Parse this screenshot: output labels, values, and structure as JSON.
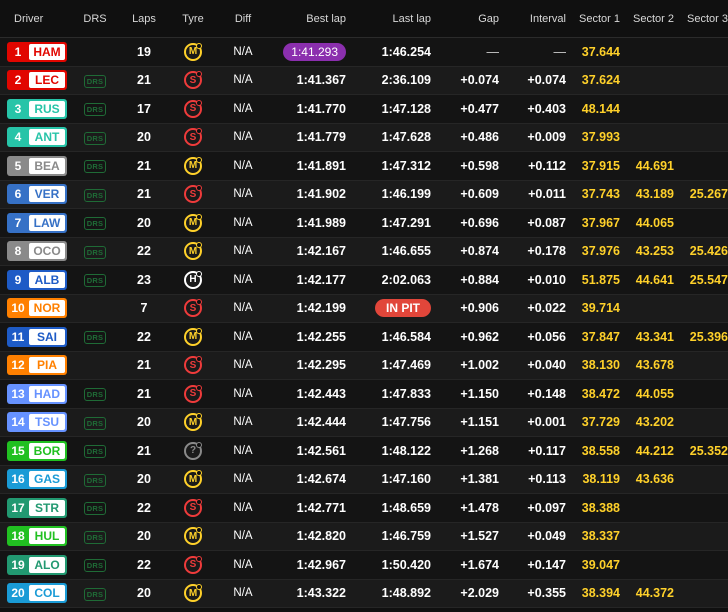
{
  "columns": {
    "driver": "Driver",
    "drs": "DRS",
    "laps": "Laps",
    "tyre": "Tyre",
    "diff": "Diff",
    "best_lap": "Best lap",
    "last_lap": "Last lap",
    "gap": "Gap",
    "interval": "Interval",
    "sector1": "Sector 1",
    "sector2": "Sector 2",
    "sector3": "Sector 3"
  },
  "tyre_colors": {
    "S": "#ef3b3b",
    "M": "#ffd12a",
    "H": "#ffffff",
    "?": "#8a8a8a"
  },
  "rows": [
    {
      "pos": "1",
      "abbr": "HAM",
      "team_color": "#e10600",
      "drs": "",
      "laps": "19",
      "tyre": "M",
      "diff": "N/A",
      "best_lap": "1:41.293",
      "best_purple": true,
      "last_lap": "1:46.254",
      "in_pit": false,
      "gap": "—",
      "interval": "—",
      "s1": "37.644",
      "s2": "",
      "s3": ""
    },
    {
      "pos": "2",
      "abbr": "LEC",
      "team_color": "#e10600",
      "drs": "DRS",
      "laps": "21",
      "tyre": "S",
      "diff": "N/A",
      "best_lap": "1:41.367",
      "best_purple": false,
      "last_lap": "2:36.109",
      "in_pit": false,
      "gap": "+0.074",
      "interval": "+0.074",
      "s1": "37.624",
      "s2": "",
      "s3": ""
    },
    {
      "pos": "3",
      "abbr": "RUS",
      "team_color": "#27c4a8",
      "drs": "DRS",
      "laps": "17",
      "tyre": "S",
      "diff": "N/A",
      "best_lap": "1:41.770",
      "best_purple": false,
      "last_lap": "1:47.128",
      "in_pit": false,
      "gap": "+0.477",
      "interval": "+0.403",
      "s1": "48.144",
      "s2": "",
      "s3": ""
    },
    {
      "pos": "4",
      "abbr": "ANT",
      "team_color": "#27c4a8",
      "drs": "DRS",
      "laps": "20",
      "tyre": "S",
      "diff": "N/A",
      "best_lap": "1:41.779",
      "best_purple": false,
      "last_lap": "1:47.628",
      "in_pit": false,
      "gap": "+0.486",
      "interval": "+0.009",
      "s1": "37.993",
      "s2": "",
      "s3": ""
    },
    {
      "pos": "5",
      "abbr": "BEA",
      "team_color": "#8a8a8a",
      "drs": "DRS",
      "laps": "21",
      "tyre": "M",
      "diff": "N/A",
      "best_lap": "1:41.891",
      "best_purple": false,
      "last_lap": "1:47.312",
      "in_pit": false,
      "gap": "+0.598",
      "interval": "+0.112",
      "s1": "37.915",
      "s2": "44.691",
      "s3": ""
    },
    {
      "pos": "6",
      "abbr": "VER",
      "team_color": "#3671c6",
      "drs": "DRS",
      "laps": "21",
      "tyre": "S",
      "diff": "N/A",
      "best_lap": "1:41.902",
      "best_purple": false,
      "last_lap": "1:46.199",
      "in_pit": false,
      "gap": "+0.609",
      "interval": "+0.011",
      "s1": "37.743",
      "s2": "43.189",
      "s3": "25.267"
    },
    {
      "pos": "7",
      "abbr": "LAW",
      "team_color": "#3671c6",
      "drs": "DRS",
      "laps": "20",
      "tyre": "M",
      "diff": "N/A",
      "best_lap": "1:41.989",
      "best_purple": false,
      "last_lap": "1:47.291",
      "in_pit": false,
      "gap": "+0.696",
      "interval": "+0.087",
      "s1": "37.967",
      "s2": "44.065",
      "s3": ""
    },
    {
      "pos": "8",
      "abbr": "OCO",
      "team_color": "#8a8a8a",
      "drs": "DRS",
      "laps": "22",
      "tyre": "M",
      "diff": "N/A",
      "best_lap": "1:42.167",
      "best_purple": false,
      "last_lap": "1:46.655",
      "in_pit": false,
      "gap": "+0.874",
      "interval": "+0.178",
      "s1": "37.976",
      "s2": "43.253",
      "s3": "25.426"
    },
    {
      "pos": "9",
      "abbr": "ALB",
      "team_color": "#1e5bc6",
      "drs": "DRS",
      "laps": "23",
      "tyre": "H",
      "diff": "N/A",
      "best_lap": "1:42.177",
      "best_purple": false,
      "last_lap": "2:02.063",
      "in_pit": false,
      "gap": "+0.884",
      "interval": "+0.010",
      "s1": "51.875",
      "s2": "44.641",
      "s3": "25.547"
    },
    {
      "pos": "10",
      "abbr": "NOR",
      "team_color": "#ff8000",
      "drs": "",
      "laps": "7",
      "tyre": "S",
      "diff": "N/A",
      "best_lap": "1:42.199",
      "best_purple": false,
      "last_lap": "IN PIT",
      "in_pit": true,
      "gap": "+0.906",
      "interval": "+0.022",
      "s1": "39.714",
      "s2": "",
      "s3": ""
    },
    {
      "pos": "11",
      "abbr": "SAI",
      "team_color": "#1e5bc6",
      "drs": "DRS",
      "laps": "22",
      "tyre": "M",
      "diff": "N/A",
      "best_lap": "1:42.255",
      "best_purple": false,
      "last_lap": "1:46.584",
      "in_pit": false,
      "gap": "+0.962",
      "interval": "+0.056",
      "s1": "37.847",
      "s2": "43.341",
      "s3": "25.396"
    },
    {
      "pos": "12",
      "abbr": "PIA",
      "team_color": "#ff8000",
      "drs": "",
      "laps": "21",
      "tyre": "S",
      "diff": "N/A",
      "best_lap": "1:42.295",
      "best_purple": false,
      "last_lap": "1:47.469",
      "in_pit": false,
      "gap": "+1.002",
      "interval": "+0.040",
      "s1": "38.130",
      "s2": "43.678",
      "s3": ""
    },
    {
      "pos": "13",
      "abbr": "HAD",
      "team_color": "#6692ff",
      "drs": "DRS",
      "laps": "21",
      "tyre": "S",
      "diff": "N/A",
      "best_lap": "1:42.443",
      "best_purple": false,
      "last_lap": "1:47.833",
      "in_pit": false,
      "gap": "+1.150",
      "interval": "+0.148",
      "s1": "38.472",
      "s2": "44.055",
      "s3": ""
    },
    {
      "pos": "14",
      "abbr": "TSU",
      "team_color": "#6692ff",
      "drs": "DRS",
      "laps": "20",
      "tyre": "M",
      "diff": "N/A",
      "best_lap": "1:42.444",
      "best_purple": false,
      "last_lap": "1:47.756",
      "in_pit": false,
      "gap": "+1.151",
      "interval": "+0.001",
      "s1": "37.729",
      "s2": "43.202",
      "s3": ""
    },
    {
      "pos": "15",
      "abbr": "BOR",
      "team_color": "#21c021",
      "drs": "DRS",
      "laps": "21",
      "tyre": "?",
      "diff": "N/A",
      "best_lap": "1:42.561",
      "best_purple": false,
      "last_lap": "1:48.122",
      "in_pit": false,
      "gap": "+1.268",
      "interval": "+0.117",
      "s1": "38.558",
      "s2": "44.212",
      "s3": "25.352"
    },
    {
      "pos": "16",
      "abbr": "GAS",
      "team_color": "#1a9bd6",
      "drs": "DRS",
      "laps": "20",
      "tyre": "M",
      "diff": "N/A",
      "best_lap": "1:42.674",
      "best_purple": false,
      "last_lap": "1:47.160",
      "in_pit": false,
      "gap": "+1.381",
      "interval": "+0.113",
      "s1": "38.119",
      "s2": "43.636",
      "s3": ""
    },
    {
      "pos": "17",
      "abbr": "STR",
      "team_color": "#229971",
      "drs": "DRS",
      "laps": "22",
      "tyre": "S",
      "diff": "N/A",
      "best_lap": "1:42.771",
      "best_purple": false,
      "last_lap": "1:48.659",
      "in_pit": false,
      "gap": "+1.478",
      "interval": "+0.097",
      "s1": "38.388",
      "s2": "",
      "s3": ""
    },
    {
      "pos": "18",
      "abbr": "HUL",
      "team_color": "#21c021",
      "drs": "DRS",
      "laps": "20",
      "tyre": "M",
      "diff": "N/A",
      "best_lap": "1:42.820",
      "best_purple": false,
      "last_lap": "1:46.759",
      "in_pit": false,
      "gap": "+1.527",
      "interval": "+0.049",
      "s1": "38.337",
      "s2": "",
      "s3": ""
    },
    {
      "pos": "19",
      "abbr": "ALO",
      "team_color": "#229971",
      "drs": "DRS",
      "laps": "22",
      "tyre": "S",
      "diff": "N/A",
      "best_lap": "1:42.967",
      "best_purple": false,
      "last_lap": "1:50.420",
      "in_pit": false,
      "gap": "+1.674",
      "interval": "+0.147",
      "s1": "39.047",
      "s2": "",
      "s3": ""
    },
    {
      "pos": "20",
      "abbr": "COL",
      "team_color": "#1a9bd6",
      "drs": "DRS",
      "laps": "20",
      "tyre": "M",
      "diff": "N/A",
      "best_lap": "1:43.322",
      "best_purple": false,
      "last_lap": "1:48.892",
      "in_pit": false,
      "gap": "+2.029",
      "interval": "+0.355",
      "s1": "38.394",
      "s2": "44.372",
      "s3": ""
    }
  ]
}
